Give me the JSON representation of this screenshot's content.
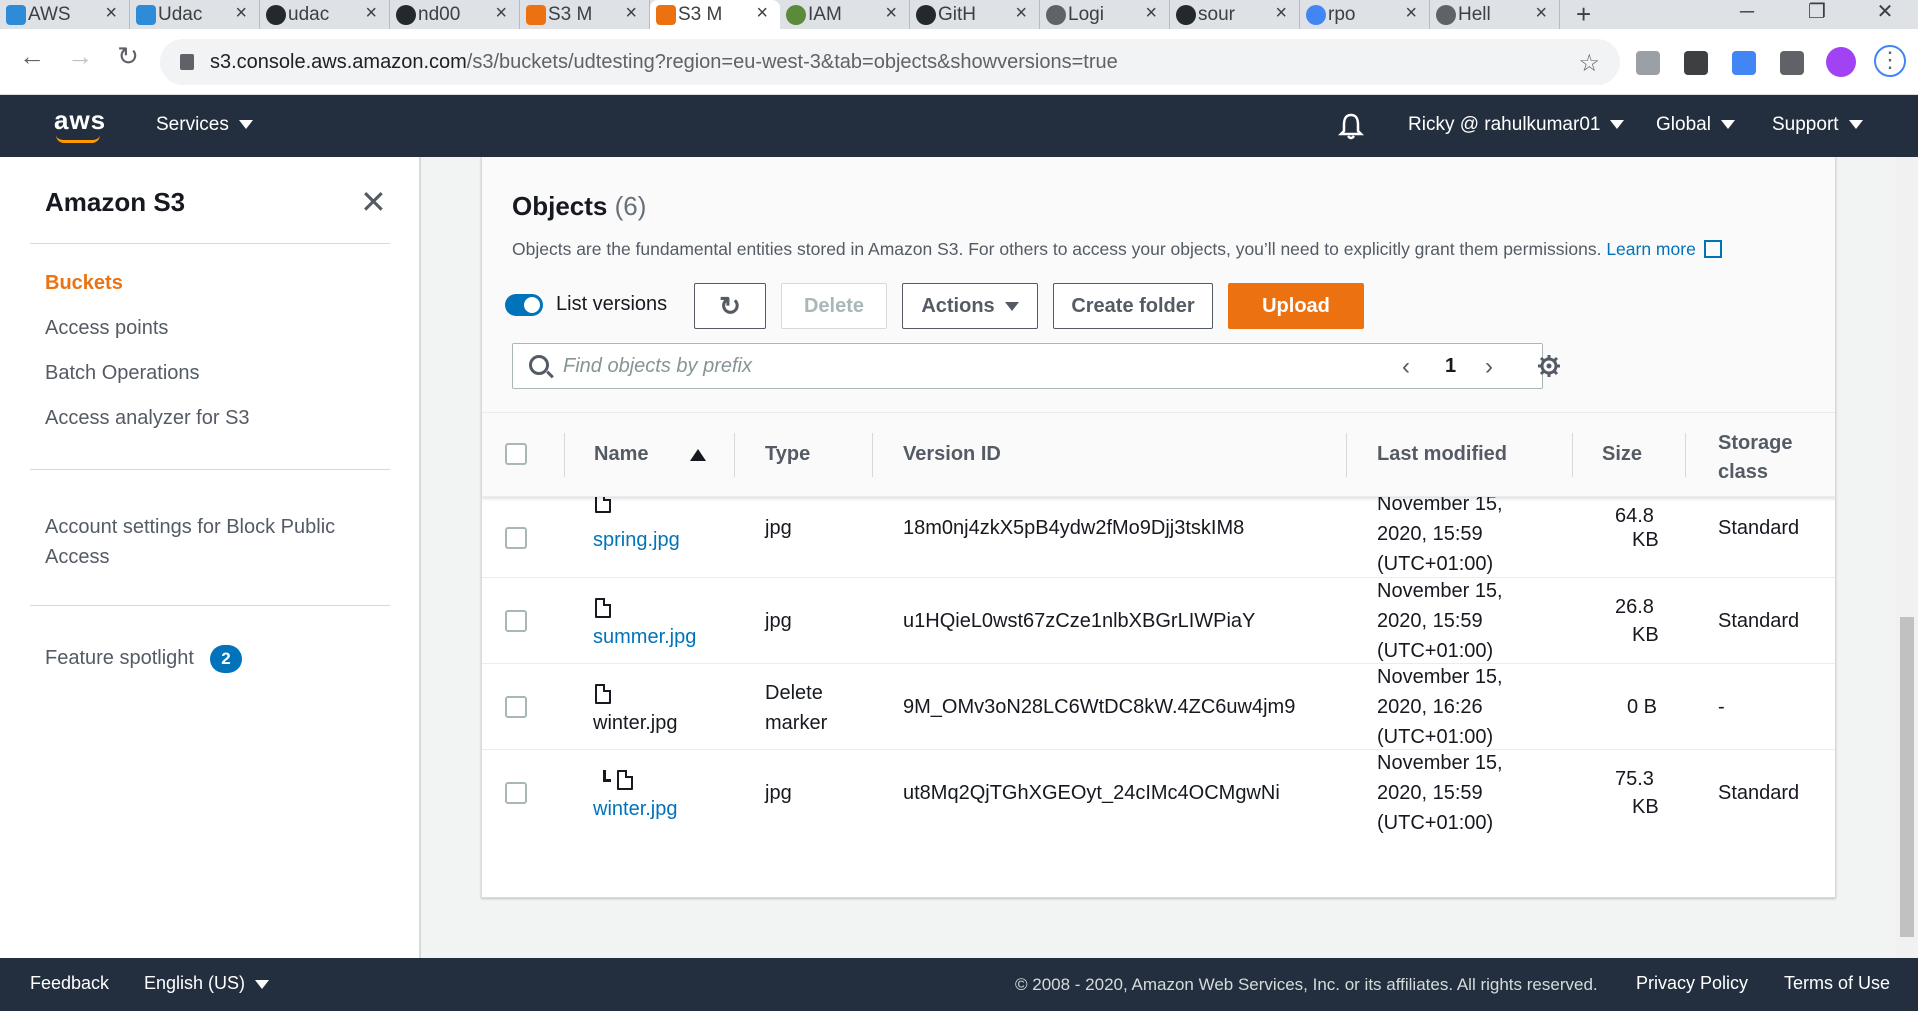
{
  "browser": {
    "tabs": [
      {
        "label": "AWS",
        "color": "#2e8bd8"
      },
      {
        "label": "Udac",
        "color": "#2e8bd8"
      },
      {
        "label": "udac",
        "color": "#24292e"
      },
      {
        "label": "nd00",
        "color": "#24292e"
      },
      {
        "label": "S3 M",
        "color": "#ec7211"
      },
      {
        "label": "S3 M",
        "color": "#ec7211"
      },
      {
        "label": "IAM",
        "color": "#5b8a3a"
      },
      {
        "label": "GitH",
        "color": "#24292e"
      },
      {
        "label": "Logi",
        "color": "#5f6368"
      },
      {
        "label": "sour",
        "color": "#24292e"
      },
      {
        "label": "rpo",
        "color": "#4285f4"
      },
      {
        "label": "Hell",
        "color": "#5f6368"
      }
    ],
    "url_host": "s3.console.aws.amazon.com",
    "url_path": "/s3/buckets/udtesting?region=eu-west-3&tab=objects&showversions=true"
  },
  "topnav": {
    "logo": "aws",
    "services": "Services",
    "account": "Ricky @ rahulkumar01",
    "region": "Global",
    "support": "Support"
  },
  "sidebar": {
    "title": "Amazon S3",
    "items": [
      {
        "label": "Buckets"
      },
      {
        "label": "Access points"
      },
      {
        "label": "Batch Operations"
      },
      {
        "label": "Access analyzer for S3"
      }
    ],
    "account_settings_line1": "Account settings for Block Public",
    "account_settings_line2": "Access",
    "feature_spotlight": "Feature spotlight",
    "feature_badge": "2"
  },
  "objects": {
    "title": "Objects",
    "count": "(6)",
    "description": "Objects are the fundamental entities stored in Amazon S3. For others to access your objects, you’ll need to explicitly grant them permissions.",
    "learn_more": "Learn more",
    "list_versions": "List versions",
    "delete": "Delete",
    "actions": "Actions",
    "create_folder": "Create folder",
    "upload": "Upload",
    "search_placeholder": "Find objects by prefix",
    "page": "1",
    "columns": {
      "name": "Name",
      "type": "Type",
      "version_id": "Version ID",
      "last_modified": "Last modified",
      "size": "Size",
      "storage_class_1": "Storage",
      "storage_class_2": "class"
    },
    "rows": [
      {
        "name": "spring.jpg",
        "type": "jpg",
        "version": "18m0nj4zkX5pB4ydw2fMo9Djj3tskIM8",
        "date_1": "November 15,",
        "date_2": "2020, 15:59",
        "date_3": "(UTC+01:00)",
        "size_1": "64.8",
        "size_2": "KB",
        "storage": "Standard"
      },
      {
        "name": "summer.jpg",
        "type": "jpg",
        "version": "u1HQieL0wst67zCze1nlbXBGrLIWPiaY",
        "date_1": "November 15,",
        "date_2": "2020, 15:59",
        "date_3": "(UTC+01:00)",
        "size_1": "26.8",
        "size_2": "KB",
        "storage": "Standard"
      },
      {
        "name": "winter.jpg",
        "type_1": "Delete",
        "type_2": "marker",
        "version": "9M_OMv3oN28LC6WtDC8kW.4ZC6uw4jm9",
        "date_1": "November 15,",
        "date_2": "2020, 16:26",
        "date_3": "(UTC+01:00)",
        "size_1": "0 B",
        "storage": "-"
      },
      {
        "name": "winter.jpg",
        "type": "jpg",
        "version": "ut8Mq2QjTGhXGEOyt_24cIMc4OCMgwNi",
        "date_1": "November 15,",
        "date_2": "2020, 15:59",
        "date_3": "(UTC+01:00)",
        "size_1": "75.3",
        "size_2": "KB",
        "storage": "Standard"
      }
    ]
  },
  "footer": {
    "feedback": "Feedback",
    "language": "English (US)",
    "copyright": "© 2008 - 2020, Amazon Web Services, Inc. or its affiliates. All rights reserved.",
    "privacy": "Privacy Policy",
    "terms": "Terms of Use"
  },
  "colors": {
    "accent": "#ec7211",
    "link": "#0073bb",
    "nav_bg": "#232f3e"
  }
}
